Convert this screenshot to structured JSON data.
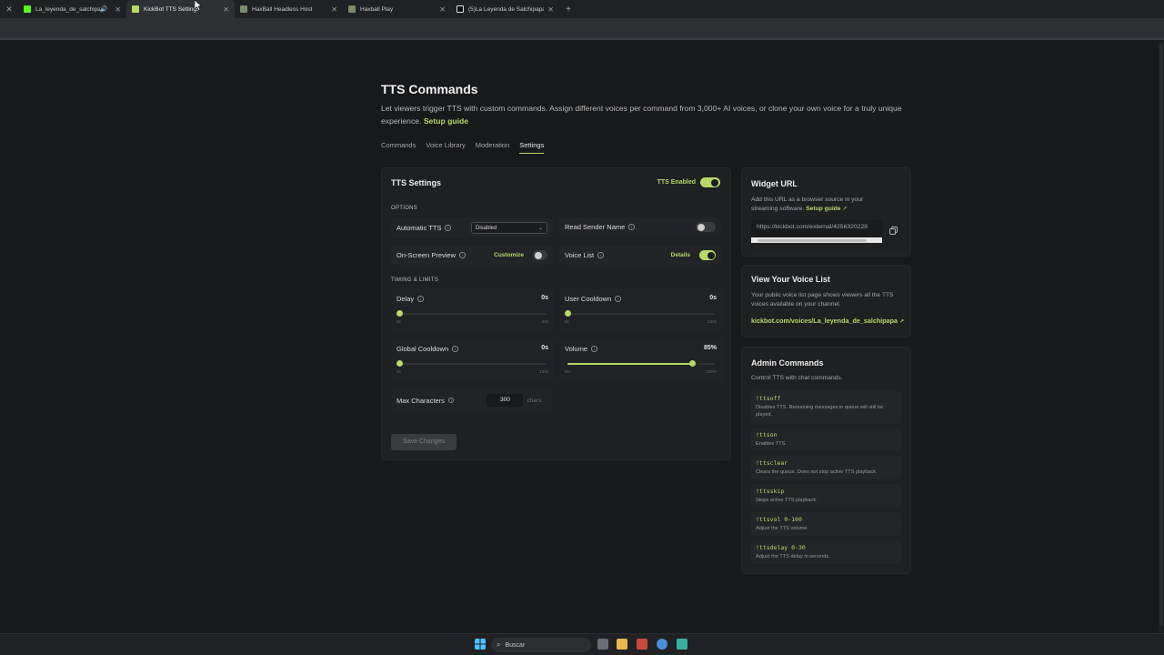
{
  "browser": {
    "tabs": [
      {
        "title": "La_leyenda_de_salchipapa",
        "favicon_color": "#53fc18",
        "audio": true
      },
      {
        "title": "KickBot TTS Settings",
        "favicon_color": "#b9d86a",
        "active": true
      },
      {
        "title": "HaxBall Headless Host",
        "favicon_color": "#7a8a6a"
      },
      {
        "title": "Haxball Play",
        "favicon_color": "#7a8a6a"
      },
      {
        "title": "(5)La Leyenda de Salchipapa (@",
        "favicon_color": "#ffffff"
      }
    ],
    "new_tab_label": "+"
  },
  "header": {
    "title": "TTS Commands",
    "description": "Let viewers trigger TTS with custom commands. Assign different voices per command from 3,000+ AI voices, or clone your own voice for a truly unique experience.",
    "setup_link": "Setup guide"
  },
  "subnav": {
    "items": [
      "Commands",
      "Voice Library",
      "Moderation",
      "Settings"
    ],
    "active": "Settings"
  },
  "tts_settings": {
    "title": "TTS Settings",
    "enabled_label": "TTS Enabled",
    "enabled": true,
    "options_label": "OPTIONS",
    "automatic_tts_label": "Automatic TTS",
    "automatic_tts_value": "Disabled",
    "read_sender_label": "Read Sender Name",
    "read_sender_on": false,
    "onscreen_label": "On-Screen Preview",
    "onscreen_customize": "Customize",
    "onscreen_on": false,
    "voice_list_label": "Voice List",
    "voice_list_details": "Details",
    "voice_list_on": true,
    "timing_label": "TIMING & LIMITS",
    "delay": {
      "label": "Delay",
      "value": "0s",
      "fraction": 0,
      "min": "0s",
      "max": "30s"
    },
    "user_cooldown": {
      "label": "User Cooldown",
      "value": "0s",
      "fraction": 0,
      "min": "0s",
      "max": "120s"
    },
    "global_cooldown": {
      "label": "Global Cooldown",
      "value": "0s",
      "fraction": 0,
      "min": "0s",
      "max": "120s"
    },
    "volume": {
      "label": "Volume",
      "value": "85%",
      "fraction": 0.85,
      "min": "0%",
      "max": "100%"
    },
    "max_chars_label": "Max Characters",
    "max_chars_value": "300",
    "max_chars_unit": "chars",
    "save_label": "Save Changes"
  },
  "widget": {
    "title": "Widget URL",
    "desc": "Add this URL as a browser source in your streaming software.",
    "setup_link": "Setup guide",
    "url": "https://kickbot.com/external/4256320228"
  },
  "voice_list": {
    "title": "View Your Voice List",
    "desc": "Your public voice list page shows viewers all the TTS voices available on your channel.",
    "link": "kickbot.com/voices/La_leyenda_de_salchipapa"
  },
  "admin": {
    "title": "Admin Commands",
    "desc": "Control TTS with chat commands.",
    "commands": [
      {
        "code": "!ttsoff",
        "desc": "Disables TTS. Remaining messages in queue will still be played."
      },
      {
        "code": "!ttson",
        "desc": "Enables TTS."
      },
      {
        "code": "!ttsclear",
        "desc": "Clears the queue. Does not stop active TTS playback."
      },
      {
        "code": "!ttsskip",
        "desc": "Stops active TTS playback."
      },
      {
        "code": "!ttsvol 0-100",
        "desc": "Adjust the TTS volume."
      },
      {
        "code": "!ttsdelay 0-30",
        "desc": "Adjust the TTS delay in seconds."
      }
    ]
  },
  "taskbar": {
    "search_label": "Buscar"
  },
  "colors": {
    "accent": "#b9d86a",
    "background": "#18191b",
    "card": "#1f2022"
  }
}
